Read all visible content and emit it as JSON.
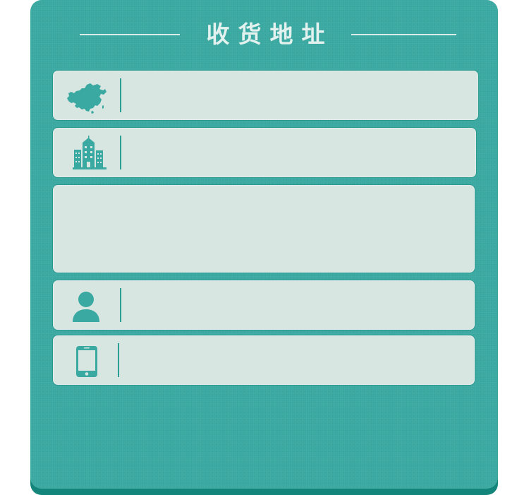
{
  "header": {
    "title": "收货地址"
  },
  "form": {
    "region": {
      "value": "",
      "placeholder": "",
      "icon": "china-map-icon"
    },
    "city": {
      "value": "",
      "placeholder": "",
      "icon": "city-buildings-icon"
    },
    "detail_address": {
      "value": "",
      "placeholder": ""
    },
    "recipient_name": {
      "value": "",
      "placeholder": "",
      "icon": "person-icon"
    },
    "phone": {
      "value": "",
      "placeholder": "",
      "icon": "mobile-phone-icon"
    }
  },
  "colors": {
    "card_bg": "#3aa9a1",
    "card_shadow": "#14857a",
    "field_bg": "#d8e6e2",
    "accent": "#2b9e95",
    "title_text": "#e3f2ef"
  }
}
